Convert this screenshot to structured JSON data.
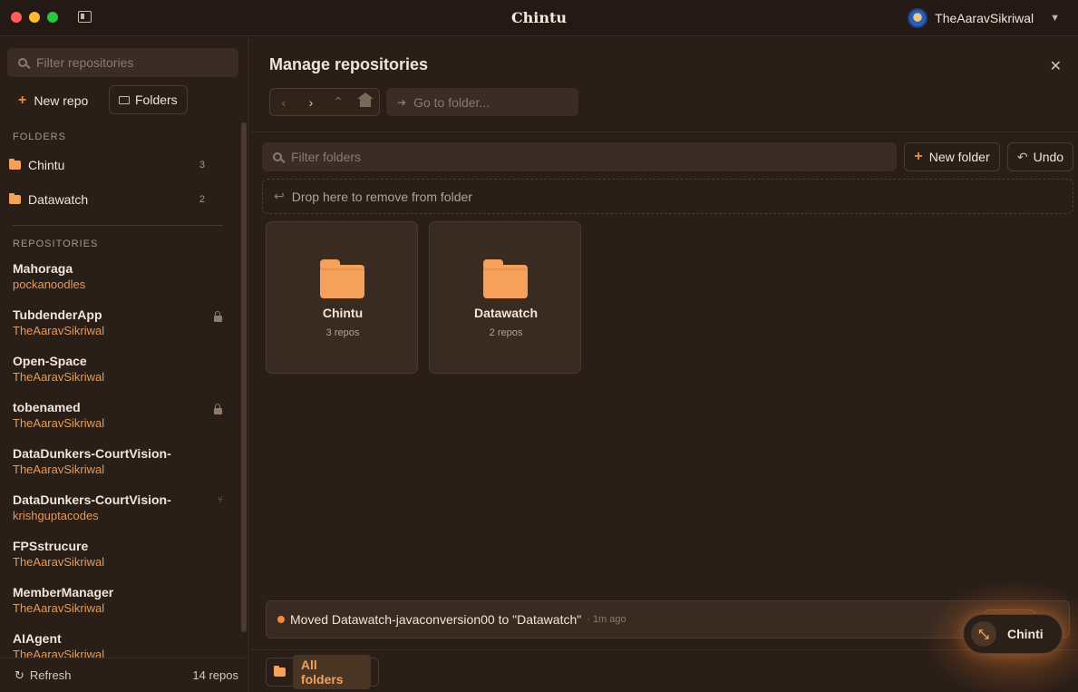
{
  "window": {
    "title": "Chintu"
  },
  "account": {
    "name": "TheAaravSikriwal"
  },
  "sidebar": {
    "search_placeholder": "Filter repositories",
    "new_repo_label": "New repo",
    "folders_button_label": "Folders",
    "folders_heading": "FOLDERS",
    "folders": [
      {
        "name": "Chintu",
        "count": "3"
      },
      {
        "name": "Datawatch",
        "count": "2"
      }
    ],
    "repositories_heading": "REPOSITORIES",
    "repositories": [
      {
        "name": "Mahoraga",
        "owner": "pockanoodles",
        "badge": ""
      },
      {
        "name": "TubdenderApp",
        "owner": "TheAaravSikriwal",
        "badge": "lock"
      },
      {
        "name": "Open-Space",
        "owner": "TheAaravSikriwal",
        "badge": ""
      },
      {
        "name": "tobenamed",
        "owner": "TheAaravSikriwal",
        "badge": "lock"
      },
      {
        "name": "DataDunkers-CourtVision-",
        "owner": "TheAaravSikriwal",
        "badge": ""
      },
      {
        "name": "DataDunkers-CourtVision-",
        "owner": "krishguptacodes",
        "badge": "fork"
      },
      {
        "name": "FPSstrucure",
        "owner": "TheAaravSikriwal",
        "badge": ""
      },
      {
        "name": "MemberManager",
        "owner": "TheAaravSikriwal",
        "badge": ""
      },
      {
        "name": "AIAgent",
        "owner": "TheAaravSikriwal",
        "badge": ""
      }
    ],
    "refresh_label": "Refresh",
    "repo_count": "14 repos"
  },
  "main": {
    "title": "Manage repositories",
    "goto_placeholder": "Go to folder...",
    "filter_placeholder": "Filter folders",
    "new_folder_label": "New folder",
    "undo_label": "Undo",
    "dropzone_text": "Drop here to remove from folder",
    "folder_cards": [
      {
        "name": "Chintu",
        "count": "3 repos"
      },
      {
        "name": "Datawatch",
        "count": "2 repos"
      }
    ],
    "toast": {
      "text": "Moved Datawatch-javaconversion00 to \"Datawatch\"",
      "time": "· 1m ago"
    },
    "all_folders_label": "All folders"
  },
  "assistant": {
    "label": "Chinti"
  },
  "colors": {
    "accent": "#f08a3c",
    "folder": "#f6a15a",
    "background": "#2a1e18"
  }
}
